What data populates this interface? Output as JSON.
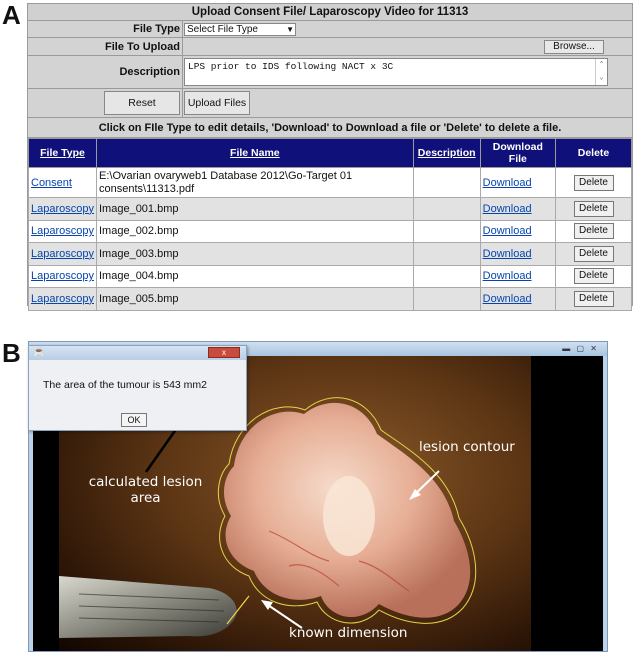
{
  "panel_labels": {
    "a": "A",
    "b": "B"
  },
  "upload_form": {
    "title": "Upload Consent File/ Laparoscopy Video for 11313",
    "file_type_label": "File Type",
    "file_type_value": "Select File Type",
    "file_to_upload_label": "File To Upload",
    "browse_label": "Browse...",
    "description_label": "Description",
    "description_value": "LPS prior to IDS following NACT x 3C",
    "reset_label": "Reset",
    "upload_label": "Upload Files",
    "instruction": "Click on FIle Type to edit details, 'Download' to Download a file or 'Delete' to delete a file."
  },
  "files_table": {
    "headers": {
      "file_type": "File Type",
      "file_name": "File Name",
      "description": "Description",
      "download_line1": "Download",
      "download_line2": "File",
      "delete": "Delete"
    },
    "rows": [
      {
        "file_type": "Consent",
        "file_name": "E:\\Ovarian ovaryweb1 Database 2012\\Go-Target 01 consents\\11313.pdf",
        "description": "",
        "download": "Download",
        "delete": "Delete"
      },
      {
        "file_type": "Laparoscopy",
        "file_name": "Image_001.bmp",
        "description": "",
        "download": "Download",
        "delete": "Delete"
      },
      {
        "file_type": "Laparoscopy",
        "file_name": "Image_002.bmp",
        "description": "",
        "download": "Download",
        "delete": "Delete"
      },
      {
        "file_type": "Laparoscopy",
        "file_name": "Image_003.bmp",
        "description": "",
        "download": "Download",
        "delete": "Delete"
      },
      {
        "file_type": "Laparoscopy",
        "file_name": "Image_004.bmp",
        "description": "",
        "download": "Download",
        "delete": "Delete"
      },
      {
        "file_type": "Laparoscopy",
        "file_name": "Image_005.bmp",
        "description": "",
        "download": "Download",
        "delete": "Delete"
      }
    ]
  },
  "popup": {
    "close_label": "x",
    "message": "The area of the tumour is 543 mm2",
    "ok_label": "OK"
  },
  "annotations": {
    "lesion_contour": "lesion contour",
    "calculated_area_line1": "calculated lesion",
    "calculated_area_line2": "area",
    "known_dimension": "known dimension"
  },
  "colors": {
    "header_bg": "#10107a",
    "link": "#0645ad",
    "contour": "#e8d24a"
  }
}
